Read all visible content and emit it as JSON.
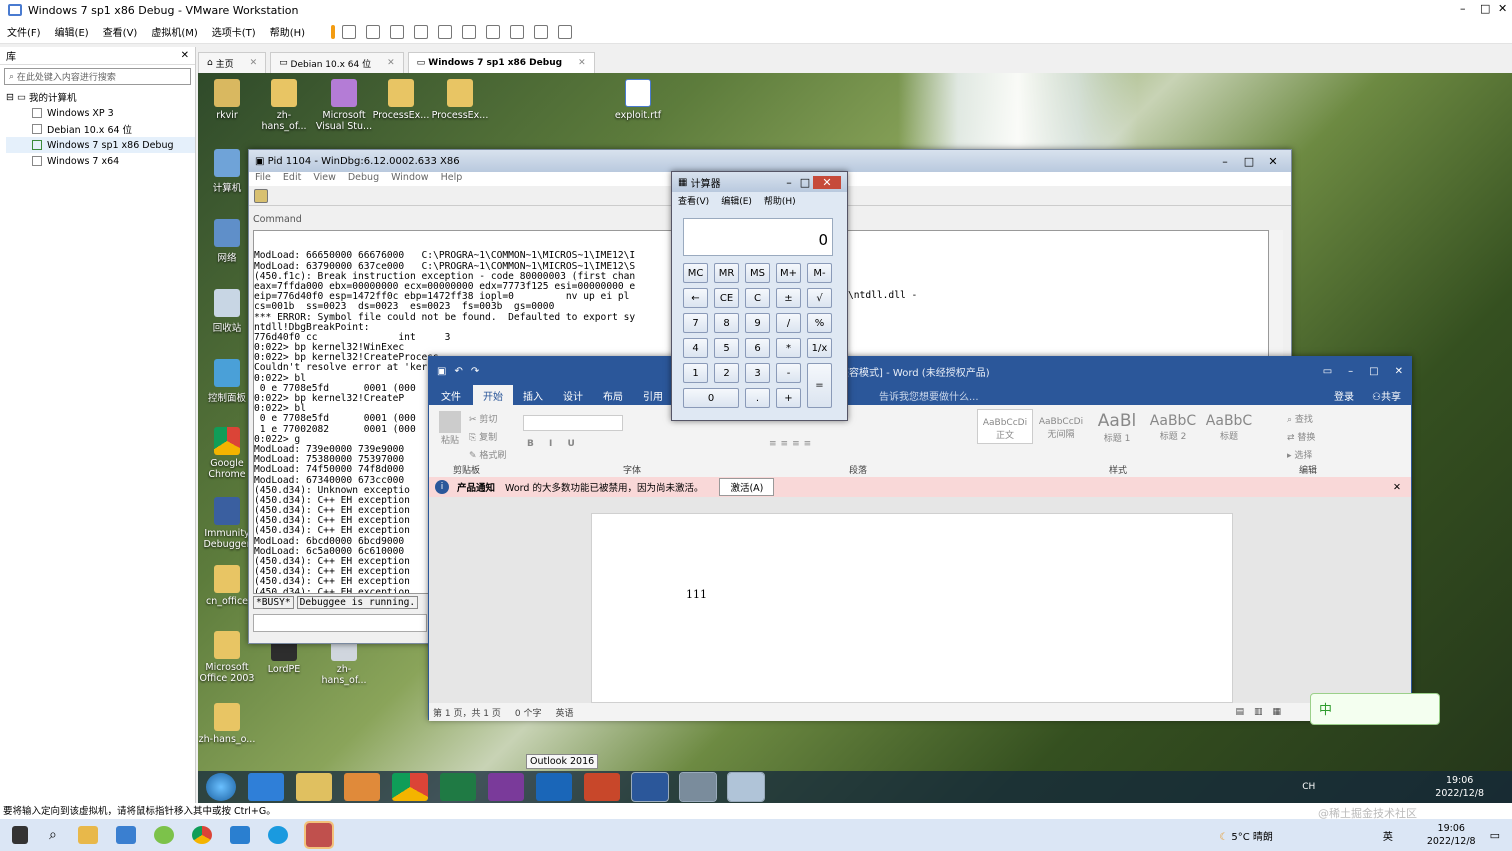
{
  "vmware": {
    "title": "Windows 7 sp1 x86 Debug - VMware Workstation",
    "menu": [
      "文件(F)",
      "编辑(E)",
      "查看(V)",
      "虚拟机(M)",
      "选项卡(T)",
      "帮助(H)"
    ],
    "library_title": "库",
    "search_placeholder": "在此处键入内容进行搜索",
    "tree_root": "我的计算机",
    "vms": [
      "Windows XP 3",
      "Debian 10.x 64 位",
      "Windows 7 sp1 x86 Debug",
      "Windows 7 x64"
    ],
    "tabs": [
      "主页",
      "Debian 10.x 64 位",
      "Windows 7 sp1 x86 Debug"
    ],
    "status": "要将输入定向到该虚拟机，请将鼠标指针移入其中或按 Ctrl+G。"
  },
  "desktop": {
    "top_icons": [
      "rkvir",
      "zh-hans_of...",
      "Microsoft Visual Stu...",
      "ProcessEx...",
      "ProcessEx...",
      "exploit.rtf"
    ],
    "left_icons": [
      "计算机",
      "网络",
      "回收站",
      "控制面板",
      "Google Chrome",
      "Immunity Debugger",
      "cn_office",
      "Microsoft Office 2003",
      "zh-hans_o..."
    ],
    "bottom_icons": [
      "LordPE",
      "zh-hans_of..."
    ]
  },
  "windbg": {
    "title": "Pid 1104 - WinDbg:6.12.0002.633 X86",
    "menu": [
      "File",
      "Edit",
      "View",
      "Debug",
      "Window",
      "Help"
    ],
    "cmd_label": "Command",
    "lines": [
      "ModLoad: 66650000 66676000   C:\\PROGRA~1\\COMMON~1\\MICROS~1\\IME12\\I",
      "ModLoad: 63790000 637ce000   C:\\PROGRA~1\\COMMON~1\\MICROS~1\\IME12\\S",
      "(450.f1c): Break instruction exception - code 80000003 (first chan",
      "eax=7ffda000 ebx=00000000 ecx=00000000 edx=7773f125 esi=00000000 e",
      "eip=776d40f0 esp=1472ff0c ebp=1472ff38 iopl=0         nv up ei pl",
      "cs=001b  ss=0023  ds=0023  es=0023  fs=003b  gs=0000",
      "*** ERROR: Symbol file could not be found.  Defaulted to export sy",
      "ntdll!DbgBreakPoint:",
      "776d40f0 cc              int     3",
      "0:022> bp kernel32!WinExec",
      "0:022> bp kernel32!CreateProcess",
      "Couldn't resolve error at 'kernel32!CreateProcess'",
      "0:022> bl",
      " 0 e 7708e5fd      0001 (000",
      "0:022> bp kernel32!CreateP",
      "0:022> bl",
      " 0 e 7708e5fd      0001 (000",
      " 1 e 77002082      0001 (000",
      "0:022> g",
      "ModLoad: 739e0000 739e9000",
      "ModLoad: 75380000 75397000",
      "ModLoad: 74f50000 74f8d000",
      "ModLoad: 67340000 673cc000",
      "(450.d34): Unknown exceptio",
      "(450.d34): C++ EH exception",
      "(450.d34): C++ EH exception",
      "(450.d34): C++ EH exception",
      "(450.d34): C++ EH exception",
      "ModLoad: 6bcd0000 6bcd9000",
      "ModLoad: 6c5a0000 6c610000",
      "(450.d34): C++ EH exception",
      "(450.d34): C++ EH exception",
      "(450.d34): C++ EH exception",
      "(450.d34): C++ EH exception"
    ],
    "tail": "\\ntdll.dll -",
    "busy": "*BUSY*",
    "running": "Debuggee is running."
  },
  "calc": {
    "title": "计算器",
    "menu": [
      "查看(V)",
      "编辑(E)",
      "帮助(H)"
    ],
    "display": "0",
    "rows": [
      [
        "MC",
        "MR",
        "MS",
        "M+",
        "M-"
      ],
      [
        "←",
        "CE",
        "C",
        "±",
        "√"
      ],
      [
        "7",
        "8",
        "9",
        "/",
        "%"
      ],
      [
        "4",
        "5",
        "6",
        "*",
        "1/x"
      ],
      [
        "1",
        "2",
        "3",
        "-",
        "="
      ],
      [
        "0",
        ".",
        "+"
      ]
    ]
  },
  "word": {
    "title": ".rtf [兼容模式] - Word (未经授权产品)",
    "tabs": [
      "文件",
      "开始",
      "插入",
      "设计",
      "布局",
      "引用"
    ],
    "tell": "告诉我您想要做什么...",
    "login": "登录",
    "share": "共享",
    "clip": [
      "剪切",
      "复制",
      "格式刷"
    ],
    "paste": "粘贴",
    "groups": [
      "剪贴板",
      "字体",
      "段落",
      "样式",
      "编辑"
    ],
    "styles": [
      [
        "AaBbCcDi",
        "正文"
      ],
      [
        "AaBbCcDi",
        "无间隔"
      ],
      [
        "AaBl",
        "标题 1"
      ],
      [
        "AaBbC",
        "标题 2"
      ],
      [
        "AaBbC",
        "标题"
      ]
    ],
    "edit": [
      "查找",
      "替换",
      "选择"
    ],
    "notice_title": "产品通知",
    "notice": "Word 的大多数功能已被禁用，因为尚未激活。",
    "activate": "激活(A)",
    "doc_text": "111",
    "status": [
      "第 1 页，共 1 页",
      "0 个字",
      "英语"
    ]
  },
  "guest_task": {
    "tooltip": "Outlook 2016",
    "ime": "CH",
    "time": "19:06",
    "date": "2022/12/8",
    "ime_bar": "中"
  },
  "host_task": {
    "weather": "5°C 晴朗",
    "time": "19:06",
    "date": "2022/12/8",
    "ime": "英",
    "watermark": "@稀土掘金技术社区"
  }
}
